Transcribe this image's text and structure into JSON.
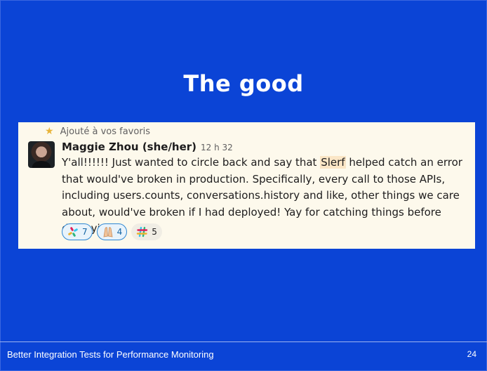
{
  "slide": {
    "title": "The good",
    "footer": "Better Integration Tests for Performance Monitoring",
    "page_number": "24"
  },
  "message": {
    "saved_label": "Ajouté à vos favoris",
    "author": "Maggie Zhou (she/her)",
    "timestamp": "12 h 32",
    "text_before": "Y'all!!!!!! Just wanted to circle back and say that ",
    "highlight": "Slerf",
    "text_after": " helped catch an error that would've broken in production. Specifically, every call to those APIs, including users.counts, conversations.history and like, other things we care about, would've broken if I had deployed! Yay for catching things before deploying!",
    "reactions": [
      {
        "icon": "slack-pinwheel-icon",
        "count": "7"
      },
      {
        "icon": "praying-hands-icon",
        "count": "4"
      },
      {
        "icon": "slack-hashtag-icon",
        "count": "5"
      }
    ]
  },
  "colors": {
    "slide_background": "#0b44d6",
    "card_background": "#fdf9ec",
    "highlight": "#fbe6c6",
    "reaction_active_border": "#2e87d3"
  }
}
